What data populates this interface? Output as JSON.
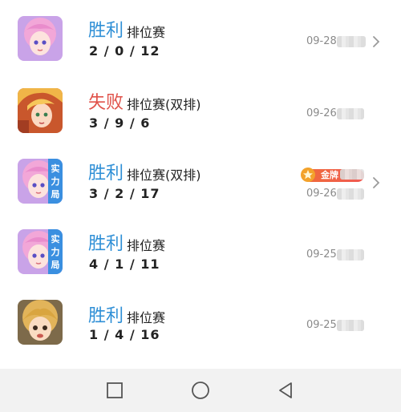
{
  "matches": [
    {
      "result": "胜利",
      "result_color": "#2f8fd6",
      "mode": "排位赛",
      "kda": "2 / 0 / 12",
      "time": "09-28",
      "hero_icon": "hero-portrait-pink-hair-icon",
      "power_tag": [],
      "badge": ""
    },
    {
      "result": "失败",
      "result_color": "#e0524a",
      "mode": "排位赛(双排)",
      "kda": "3 / 9 / 6",
      "time": "09-26",
      "hero_icon": "hero-portrait-golden-hair-icon",
      "power_tag": [],
      "badge": ""
    },
    {
      "result": "胜利",
      "result_color": "#2f8fd6",
      "mode": "排位赛(双排)",
      "kda": "3 / 2 / 17",
      "time": "09-26",
      "hero_icon": "hero-portrait-pink-hair-icon",
      "power_tag": [
        "实",
        "力",
        "局"
      ],
      "badge": "金牌"
    },
    {
      "result": "胜利",
      "result_color": "#2f8fd6",
      "mode": "排位赛",
      "kda": "4 / 1 / 11",
      "time": "09-25",
      "hero_icon": "hero-portrait-pink-hair-icon",
      "power_tag": [
        "实",
        "力",
        "局"
      ],
      "badge": ""
    },
    {
      "result": "胜利",
      "result_color": "#2f8fd6",
      "mode": "排位赛",
      "kda": "1 / 4 / 16",
      "time": "09-25",
      "hero_icon": "hero-portrait-blonde-child-icon",
      "power_tag": [],
      "badge": ""
    }
  ],
  "navbar": {
    "recent_icon": "square-recent-apps-icon",
    "home_icon": "circle-home-icon",
    "back_icon": "triangle-back-icon"
  }
}
